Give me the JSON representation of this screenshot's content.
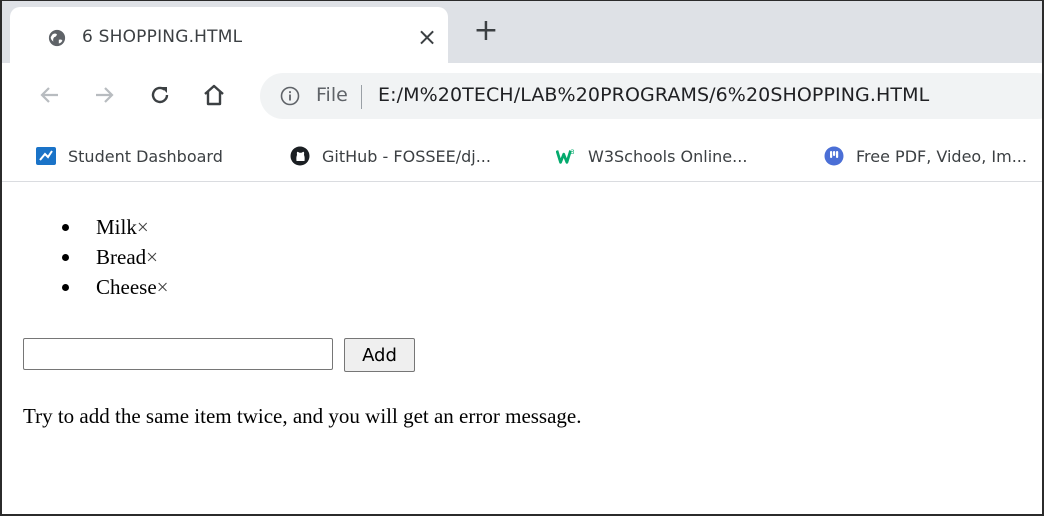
{
  "browser": {
    "tab": {
      "title": "6 SHOPPING.HTML",
      "close_glyph": "×",
      "favicon": "globe-icon"
    },
    "new_tab_glyph": "+",
    "omnibox": {
      "scheme_label": "File",
      "url": "E:/M%20TECH/LAB%20PROGRAMS/6%20SHOPPING.HTML"
    },
    "bookmarks": [
      {
        "label": "Student Dashboard",
        "icon": "dashboard-icon"
      },
      {
        "label": "GitHub - FOSSEE/dj...",
        "icon": "github-icon"
      },
      {
        "label": "W3Schools Online...",
        "icon": "w3schools-icon"
      },
      {
        "label": "Free PDF, Video, Im...",
        "icon": "pdf-tool-icon"
      }
    ]
  },
  "page": {
    "items": [
      {
        "name": "Milk",
        "remove": "×"
      },
      {
        "name": "Bread",
        "remove": "×"
      },
      {
        "name": "Cheese",
        "remove": "×"
      }
    ],
    "input_value": "",
    "add_label": "Add",
    "hint": "Try to add the same item twice, and you will get an error message."
  },
  "colors": {
    "tab_strip": "#dee1e6",
    "omnibox": "#f1f3f4",
    "text": "#3c4043"
  }
}
